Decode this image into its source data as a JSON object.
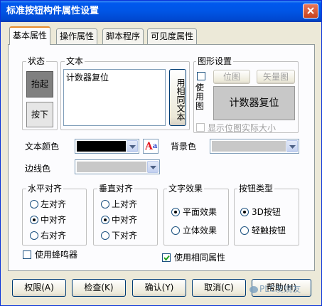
{
  "window": {
    "title": "标准按钮构件属性设置"
  },
  "tabs": [
    "基本属性",
    "操作属性",
    "脚本程序",
    "可见度属性"
  ],
  "state_group": {
    "label": "状态",
    "up": "抬起",
    "down": "按下"
  },
  "text_group": {
    "label": "文本",
    "value": "计数器复位",
    "same_text_button": "用相同文本"
  },
  "graphic_group": {
    "label": "图形设置",
    "use_graphic_label": "使用图",
    "bitmap_button": "位图",
    "vector_button": "矢量图",
    "preview_text": "计数器复位",
    "actual_size_label": "显示位图实际大小"
  },
  "colors": {
    "text_color_label": "文本颜色",
    "text_color": "#000000",
    "bg_color_label": "背景色",
    "bg_color": "#c8c8c8",
    "border_color_label": "边线色",
    "border_color": "#c8c8c8",
    "font_icon_letters": "Aa",
    "accent_red": "#e31b23",
    "accent_blue": "#2a44c8"
  },
  "halign": {
    "label": "水平对齐",
    "options": [
      "左对齐",
      "中对齐",
      "右对齐"
    ],
    "selected": 1
  },
  "valign": {
    "label": "垂直对齐",
    "options": [
      "上对齐",
      "中对齐",
      "下对齐"
    ],
    "selected": 1
  },
  "text_effect": {
    "label": "文字效果",
    "options": [
      "平面效果",
      "立体效果"
    ],
    "selected": 0
  },
  "button_type": {
    "label": "按钮类型",
    "options": [
      "3D按钮",
      "轻触按钮"
    ],
    "selected": 0
  },
  "use_buzzer": {
    "label": "使用蜂鸣器",
    "checked": false
  },
  "use_same_props": {
    "label": "使用相同属性",
    "checked": true
  },
  "footer": {
    "permission": "权限(A)",
    "check": "检查(K)",
    "confirm": "确认(Y)",
    "cancel": "取消(C)",
    "help": "帮助(H)",
    "watermark": "PLC发烧友"
  }
}
